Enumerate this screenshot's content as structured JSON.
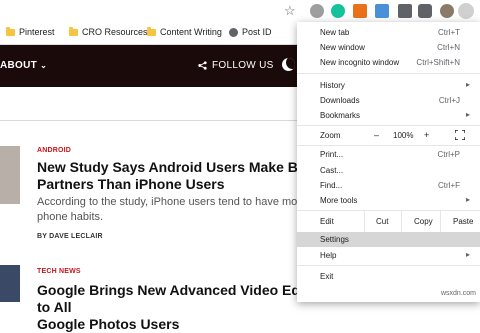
{
  "bookmarks": [
    {
      "label": "Pinterest",
      "icon": "folder"
    },
    {
      "label": "CRO Resources",
      "icon": "folder"
    },
    {
      "label": "Content Writing",
      "icon": "folder"
    },
    {
      "label": "Post ID",
      "icon": "globe"
    }
  ],
  "site": {
    "nav_about": "ABOUT",
    "follow": "FOLLOW US"
  },
  "articles": [
    {
      "category": "ANDROID",
      "title_line1": "New Study Says Android Users Make Better",
      "title_line2": "Partners Than iPhone Users",
      "excerpt_line1": "According to the study, iPhone users tend to have more a",
      "excerpt_line2": "phone habits.",
      "byline": "BY DAVE LECLAIR"
    },
    {
      "category": "TECH NEWS",
      "title_line1": "Google Brings New Advanced Video Editor to All",
      "title_line2": "Google Photos Users"
    }
  ],
  "menu": {
    "new_tab": {
      "label": "New tab",
      "shortcut": "Ctrl+T"
    },
    "new_window": {
      "label": "New window",
      "shortcut": "Ctrl+N"
    },
    "new_incognito": {
      "label": "New incognito window",
      "shortcut": "Ctrl+Shift+N"
    },
    "history": {
      "label": "History"
    },
    "downloads": {
      "label": "Downloads",
      "shortcut": "Ctrl+J"
    },
    "bookmarks": {
      "label": "Bookmarks"
    },
    "zoom": {
      "label": "Zoom",
      "minus": "–",
      "value": "100%",
      "plus": "+"
    },
    "print": {
      "label": "Print...",
      "shortcut": "Ctrl+P"
    },
    "cast": {
      "label": "Cast..."
    },
    "find": {
      "label": "Find...",
      "shortcut": "Ctrl+F"
    },
    "more_tools": {
      "label": "More tools"
    },
    "edit": {
      "label": "Edit",
      "cut": "Cut",
      "copy": "Copy",
      "paste": "Paste"
    },
    "settings": {
      "label": "Settings"
    },
    "help": {
      "label": "Help"
    },
    "exit": {
      "label": "Exit"
    }
  },
  "watermark": "wsxdn.com"
}
